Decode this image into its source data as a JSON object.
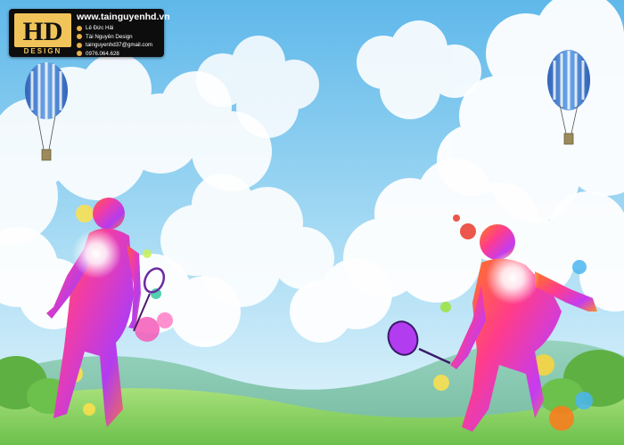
{
  "scene": {
    "description_objects": [
      "sky",
      "clouds",
      "hot-air-balloons",
      "hills",
      "badminton-players"
    ],
    "colors": {
      "sky_top": "#5fb8ea",
      "sky_bottom": "#d8f0fb",
      "grass": "#8fd36a",
      "hills": "#7cc1a8",
      "balloon_stripe": "#3e7fcf"
    }
  },
  "watermark": {
    "logo_letters": "HD",
    "logo_word": "DESIGN",
    "website": "www.tainguyenhd.vn",
    "lines": [
      {
        "icon": "facebook-icon",
        "text": "Lê Đức Hải"
      },
      {
        "icon": "facebook-icon",
        "text": "Tài Nguyên Design"
      },
      {
        "icon": "email-icon",
        "text": "tainguyenhd37@gmail.com"
      },
      {
        "icon": "phone-icon",
        "text": "0976.064.628"
      }
    ]
  }
}
